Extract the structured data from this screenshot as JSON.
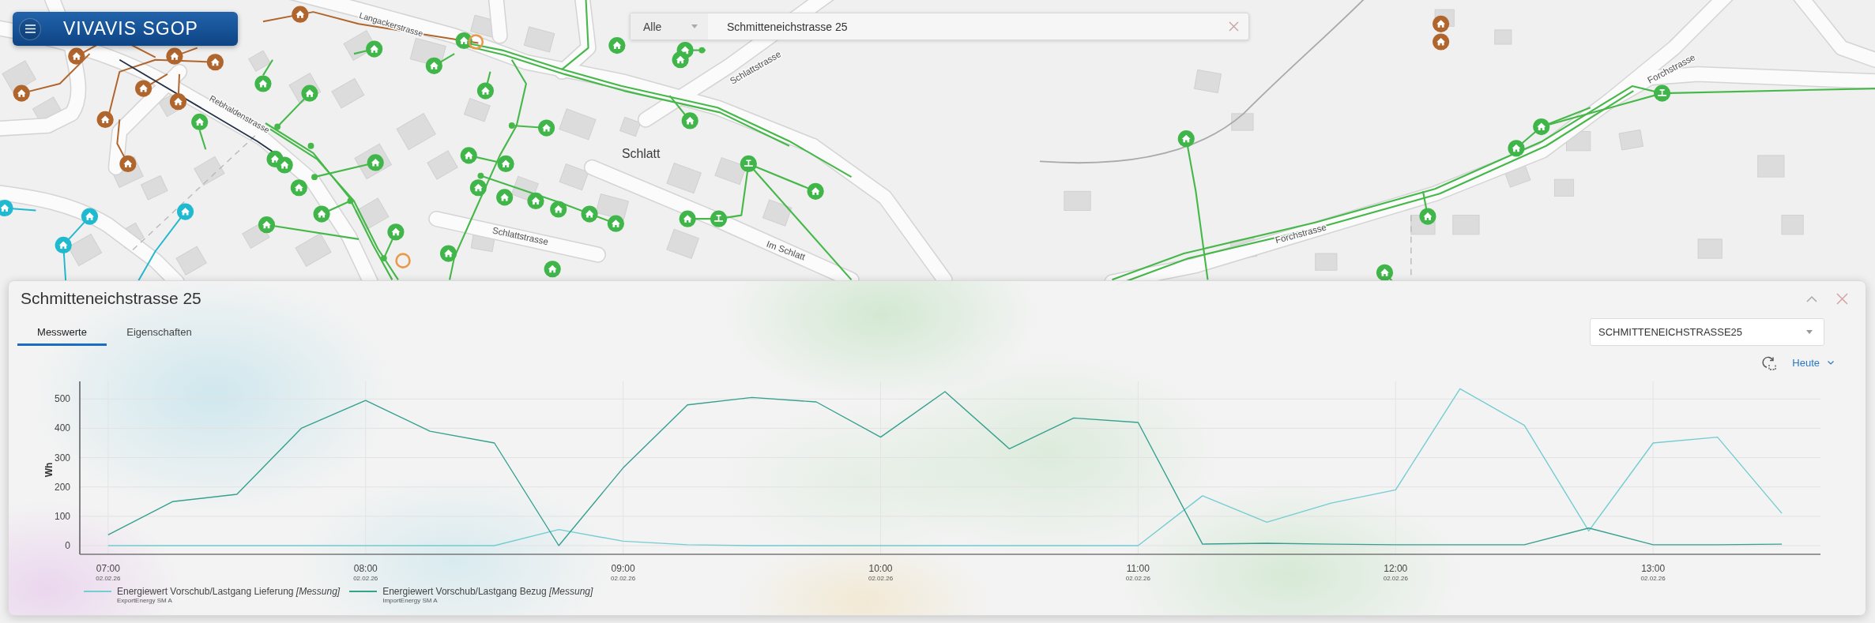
{
  "header": {
    "logo": "VIVAVIS SGOP"
  },
  "search": {
    "category": "Alle",
    "value": "Schmitteneichstrasse 25"
  },
  "map": {
    "street_labels": [
      "Langackerstrasse",
      "Rebhaldenstrasse",
      "Schlattstrasse",
      "Schlatt",
      "Schlattstrasse",
      "Im Schlatt",
      "Forchstrasse",
      "Forchstrasse"
    ]
  },
  "panel": {
    "title": "Schmitteneichstrasse 25",
    "tabs": [
      {
        "label": "Messwerte",
        "selected": true
      },
      {
        "label": "Eigenschaften",
        "selected": false
      }
    ],
    "meter_select": "SCHMITTENEICHSTRASSE25",
    "period": "Heute",
    "chart_data": {
      "type": "line",
      "ylabel": "Wh",
      "x": [
        7,
        7.25,
        7.5,
        7.75,
        8,
        8.25,
        8.5,
        8.75,
        9,
        9.25,
        9.5,
        9.75,
        10,
        10.25,
        10.5,
        10.75,
        11,
        11.25,
        11.5,
        11.75,
        12,
        12.25,
        12.5,
        12.75,
        13,
        13.25,
        13.5
      ],
      "series": [
        {
          "name": "Energiewert Vorschub/Lastgang Lieferung *[Messung]*",
          "color": "#74cdd1",
          "values": [
            0,
            0,
            0,
            0,
            0,
            0,
            0,
            55,
            15,
            3,
            0,
            0,
            0,
            0,
            0,
            0,
            0,
            170,
            80,
            145,
            190,
            535,
            410,
            50,
            350,
            370,
            110
          ]
        },
        {
          "name": "Energiewert Vorschub/Lastgang Bezug *[Messung]*",
          "color": "#36a08f",
          "values": [
            37,
            150,
            175,
            400,
            495,
            390,
            350,
            0,
            265,
            480,
            505,
            490,
            370,
            525,
            330,
            435,
            420,
            5,
            8,
            5,
            3,
            3,
            3,
            60,
            3,
            3,
            5
          ]
        }
      ],
      "xlim": [
        6.89,
        13.65
      ],
      "ylim": [
        0,
        560
      ],
      "yticks": [
        0,
        100,
        200,
        300,
        400,
        500
      ],
      "grid": true,
      "xticks": [
        {
          "value": 7,
          "label": "07:00"
        },
        {
          "value": 8,
          "label": "08:00"
        },
        {
          "value": 9,
          "label": "09:00"
        },
        {
          "value": 10,
          "label": "10:00"
        },
        {
          "value": 11,
          "label": "11:00"
        },
        {
          "value": 12,
          "label": "12:00"
        },
        {
          "value": 13,
          "label": "13:00"
        }
      ]
    },
    "x_tick_dates": [
      "02.02.26",
      "02.02.26",
      "02.02.26",
      "02.02.26",
      "02.02.26",
      "02.02.26",
      "02.02.26"
    ],
    "legend_sources": [
      "ExportEnergy SM A",
      "ImportEnergy SM A"
    ]
  }
}
